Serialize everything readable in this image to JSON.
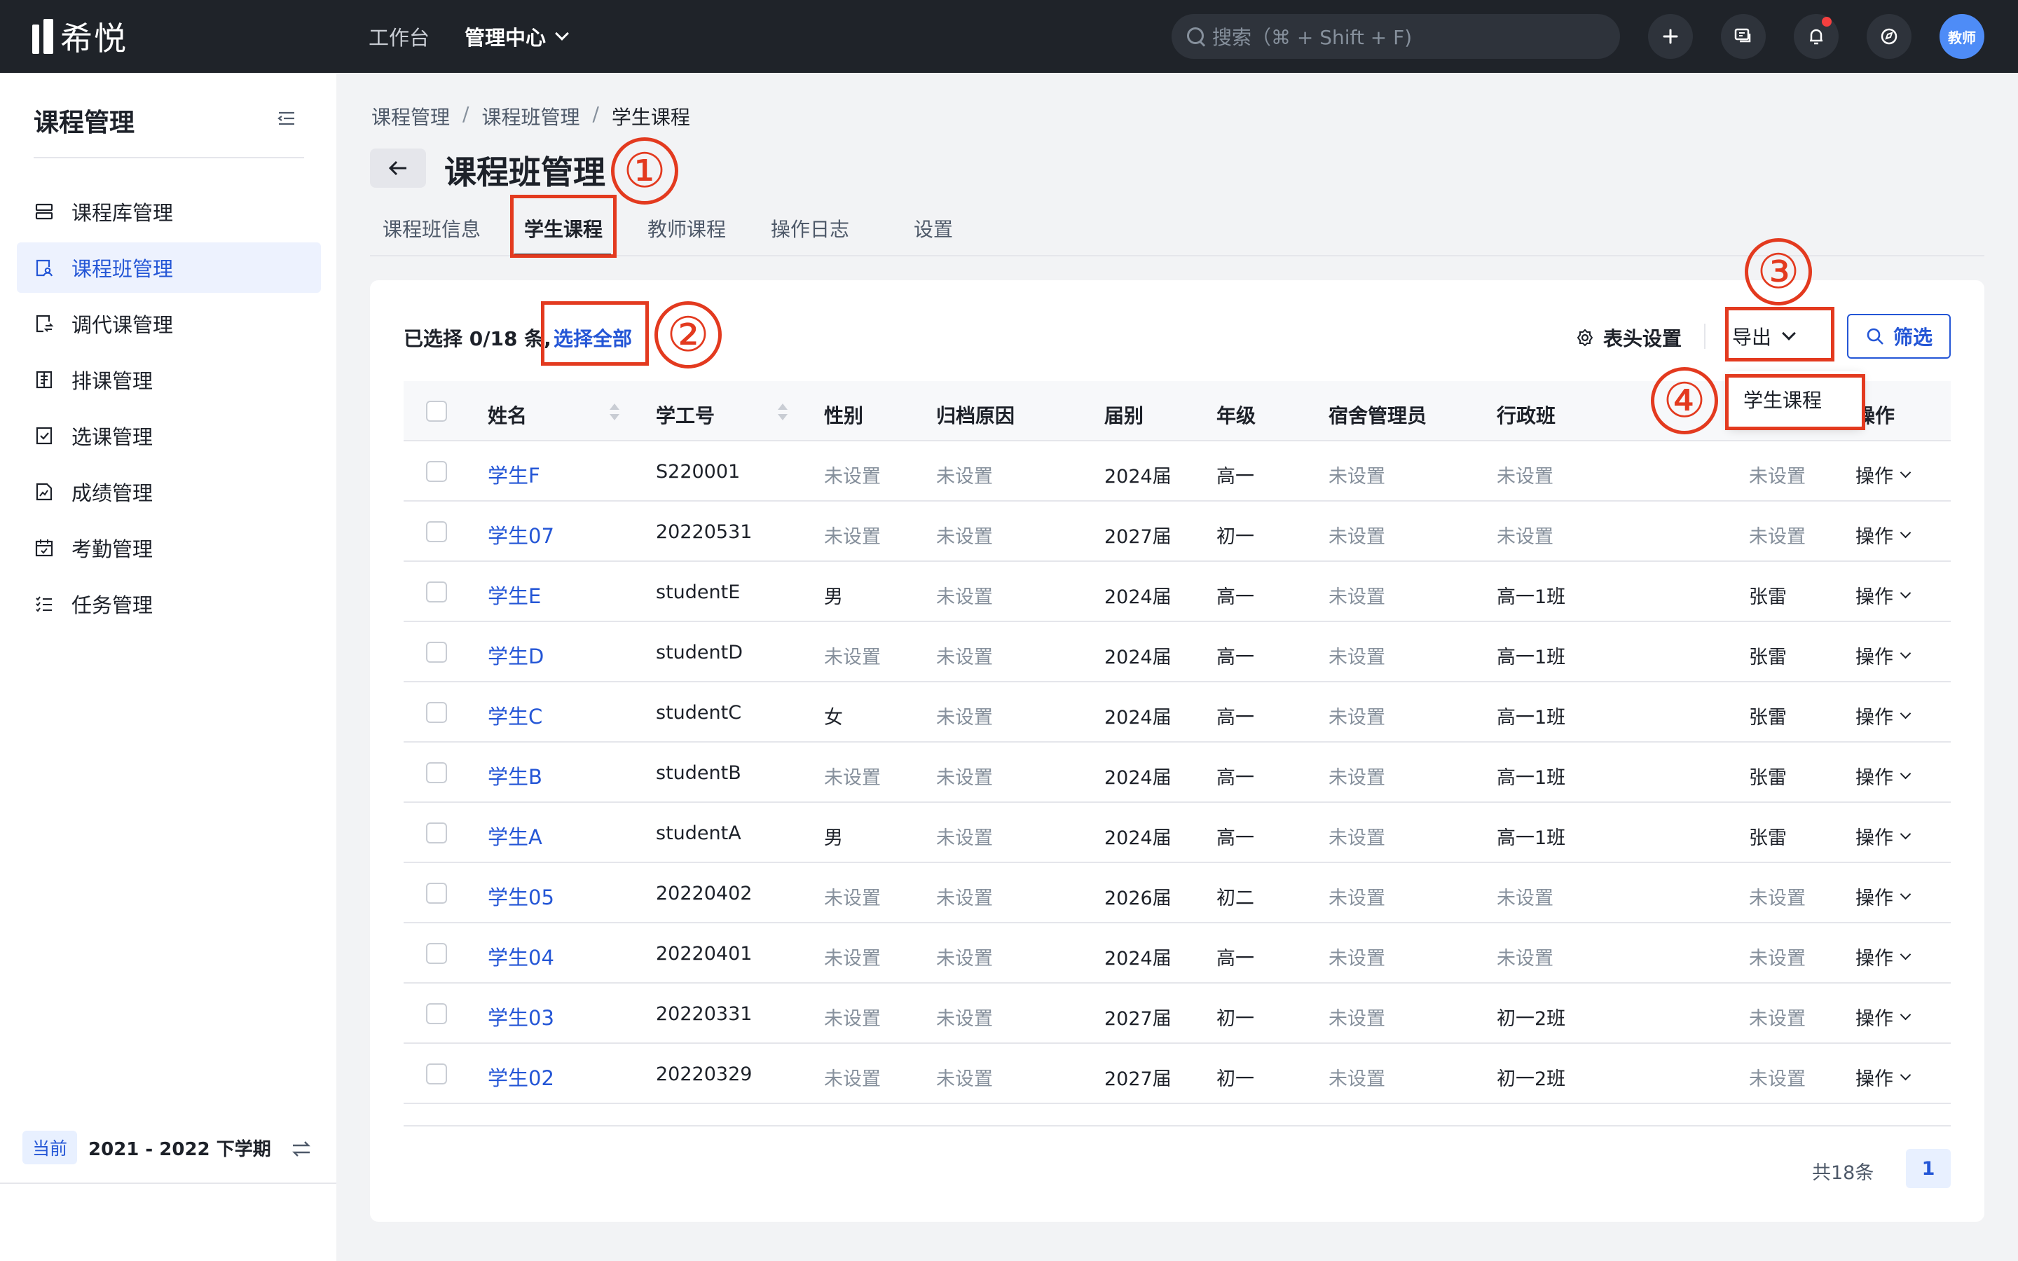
{
  "app": {
    "name": "希悦"
  },
  "topnav": {
    "workbench": "工作台",
    "admin_center": "管理中心"
  },
  "search": {
    "placeholder": "搜索（⌘ + Shift + F)"
  },
  "avatar_label": "教师",
  "sidebar": {
    "title": "课程管理",
    "items": [
      {
        "label": "课程库管理",
        "icon": "database-icon"
      },
      {
        "label": "课程班管理",
        "icon": "class-icon",
        "active": true
      },
      {
        "label": "调代课管理",
        "icon": "swap-doc-icon"
      },
      {
        "label": "排课管理",
        "icon": "schedule-icon"
      },
      {
        "label": "选课管理",
        "icon": "check-doc-icon"
      },
      {
        "label": "成绩管理",
        "icon": "chart-doc-icon"
      },
      {
        "label": "考勤管理",
        "icon": "calendar-icon"
      },
      {
        "label": "任务管理",
        "icon": "task-list-icon"
      }
    ],
    "term_tag": "当前",
    "term": "2021 - 2022 下学期"
  },
  "breadcrumb": [
    "课程管理",
    "课程班管理",
    "学生课程"
  ],
  "page_title": "课程班管理",
  "tabs": [
    "课程班信息",
    "学生课程",
    "教师课程",
    "操作日志",
    "设置"
  ],
  "active_tab": "学生课程",
  "toolbar": {
    "selected_text": "已选择 0/18 条,",
    "select_all": "选择全部",
    "column_settings": "表头设置",
    "export": "导出",
    "filter": "筛选"
  },
  "export_menu": [
    "学生课程"
  ],
  "table": {
    "columns": [
      "姓名",
      "学工号",
      "性别",
      "归档原因",
      "届别",
      "年级",
      "宿舍管理员",
      "行政班",
      "",
      "操作"
    ],
    "rows": [
      [
        "学生F",
        "S220001",
        "未设置",
        "未设置",
        "2024届",
        "高一",
        "未设置",
        "未设置",
        "未设置",
        "操作"
      ],
      [
        "学生07",
        "20220531",
        "未设置",
        "未设置",
        "2027届",
        "初一",
        "未设置",
        "未设置",
        "未设置",
        "操作"
      ],
      [
        "学生E",
        "studentE",
        "男",
        "未设置",
        "2024届",
        "高一",
        "未设置",
        "高一1班",
        "张雷",
        "操作"
      ],
      [
        "学生D",
        "studentD",
        "未设置",
        "未设置",
        "2024届",
        "高一",
        "未设置",
        "高一1班",
        "张雷",
        "操作"
      ],
      [
        "学生C",
        "studentC",
        "女",
        "未设置",
        "2024届",
        "高一",
        "未设置",
        "高一1班",
        "张雷",
        "操作"
      ],
      [
        "学生B",
        "studentB",
        "未设置",
        "未设置",
        "2024届",
        "高一",
        "未设置",
        "高一1班",
        "张雷",
        "操作"
      ],
      [
        "学生A",
        "studentA",
        "男",
        "未设置",
        "2024届",
        "高一",
        "未设置",
        "高一1班",
        "张雷",
        "操作"
      ],
      [
        "学生05",
        "20220402",
        "未设置",
        "未设置",
        "2026届",
        "初二",
        "未设置",
        "未设置",
        "未设置",
        "操作"
      ],
      [
        "学生04",
        "20220401",
        "未设置",
        "未设置",
        "2024届",
        "高一",
        "未设置",
        "未设置",
        "未设置",
        "操作"
      ],
      [
        "学生03",
        "20220331",
        "未设置",
        "未设置",
        "2027届",
        "初一",
        "未设置",
        "初一2班",
        "未设置",
        "操作"
      ],
      [
        "学生02",
        "20220329",
        "未设置",
        "未设置",
        "2027届",
        "初一",
        "未设置",
        "初一2班",
        "未设置",
        "操作"
      ]
    ]
  },
  "pagination": {
    "total": "共18条",
    "current_page": "1"
  },
  "annotations": [
    "①",
    "②",
    "③",
    "④"
  ],
  "colors": {
    "accent": "#2456d6",
    "annotation": "#e33a1f",
    "topbar": "#1f2329"
  }
}
